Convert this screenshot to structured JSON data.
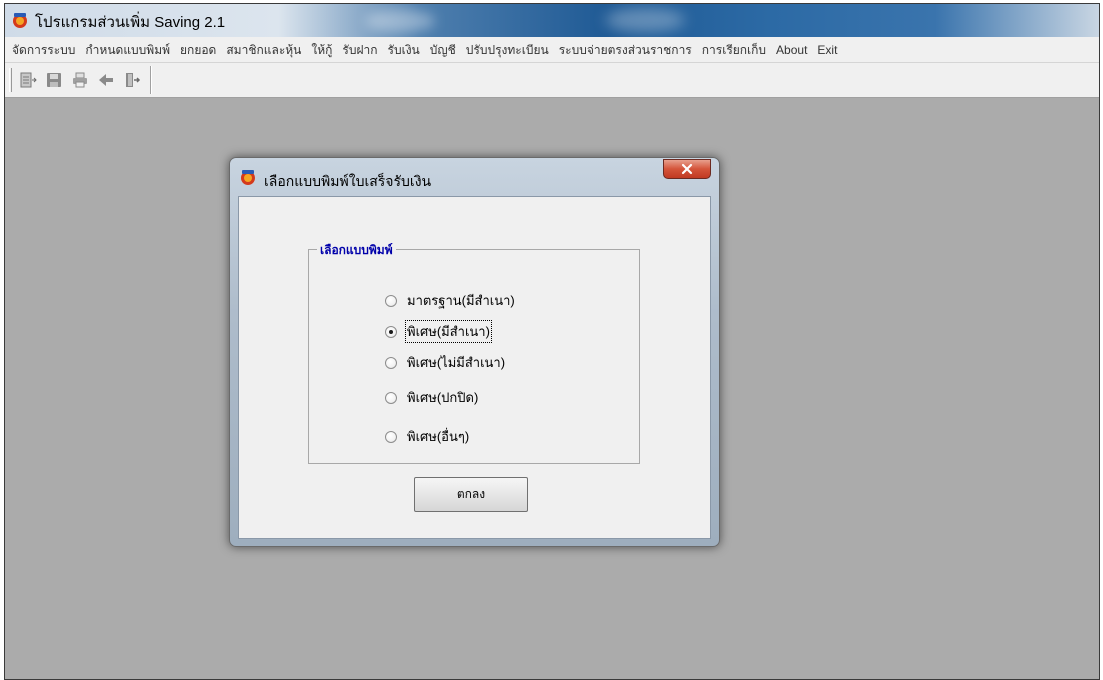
{
  "app": {
    "title": "โปรแกรมส่วนเพิ่ม Saving 2.1",
    "icon": "app-icon"
  },
  "menu": {
    "items": [
      "จัดการระบบ",
      "กำหนดแบบพิมพ์",
      "ยกยอด",
      "สมาชิกและหุ้น",
      "ให้กู้",
      "รับฝาก",
      "รับเงิน",
      "บัญชี",
      "ปรับปรุงทะเบียน",
      "ระบบจ่ายตรงส่วนราชการ",
      "การเรียกเก็บ",
      "About",
      "Exit"
    ]
  },
  "toolbar": {
    "buttons": [
      "add-record-icon",
      "save-icon",
      "print-icon",
      "back-arrow-icon",
      "exit-door-icon"
    ]
  },
  "dialog": {
    "title": "เลือกแบบพิมพ์ใบเสร็จรับเงิน",
    "close_icon": "close-icon",
    "group_label": "เลือกแบบพิมพ์",
    "options": [
      {
        "label": "มาตรฐาน(มีสำเนา)",
        "checked": false
      },
      {
        "label": "พิเศษ(มีสำเนา)",
        "checked": true
      },
      {
        "label": "พิเศษ(ไม่มีสำเนา)",
        "checked": false
      },
      {
        "label": "พิเศษ(ปกปิด)",
        "checked": false
      },
      {
        "label": "พิเศษ(อื่นๆ)",
        "checked": false
      }
    ],
    "ok_label": "ตกลง"
  },
  "colors": {
    "workspace": "#ababab",
    "group_label": "#0000aa",
    "close_button": "#c8462e"
  }
}
